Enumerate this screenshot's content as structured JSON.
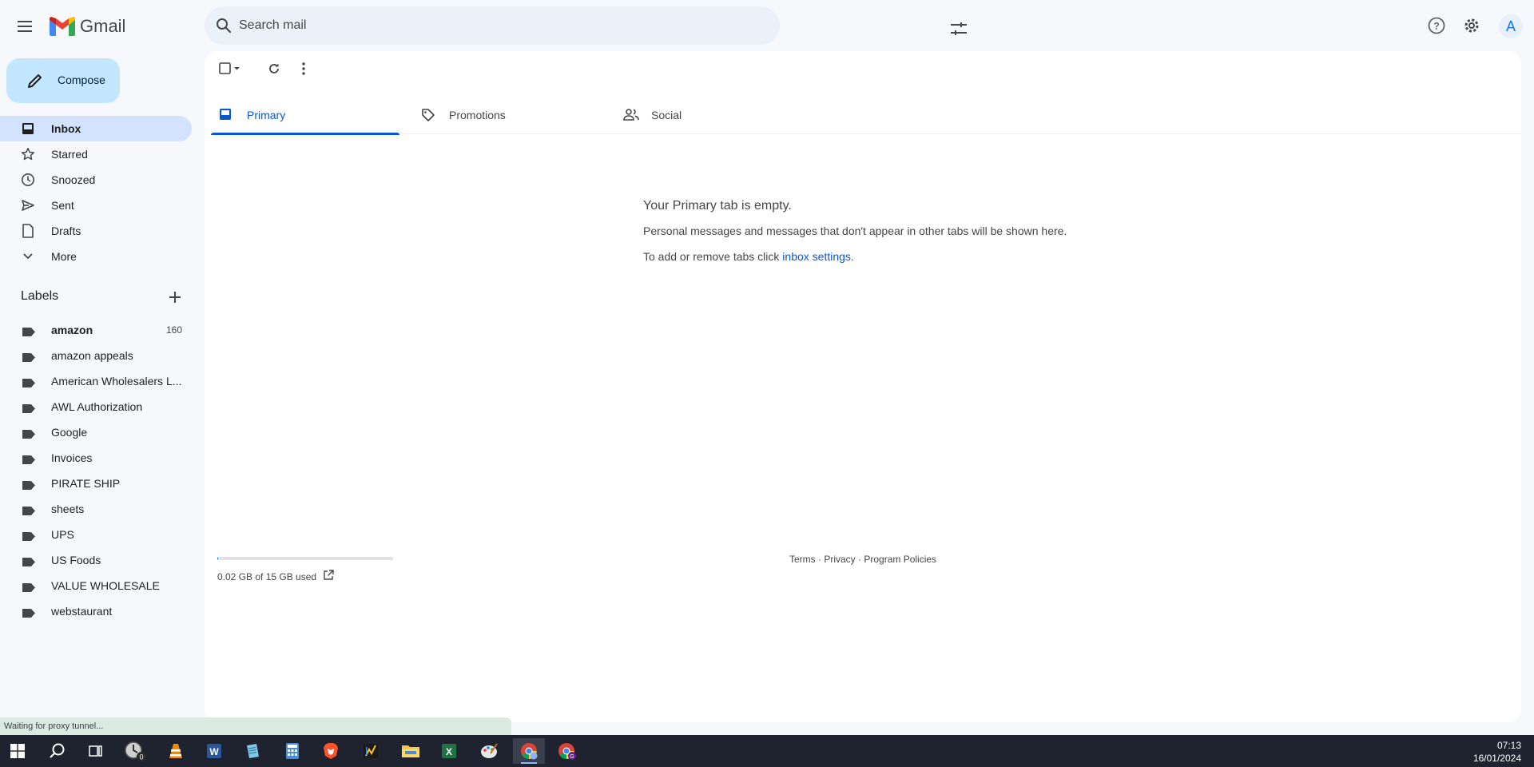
{
  "header": {
    "app_name": "Gmail",
    "search_placeholder": "Search mail",
    "avatar_initial": "A"
  },
  "sidebar": {
    "compose_label": "Compose",
    "items": [
      {
        "label": "Inbox",
        "icon": "inbox-icon",
        "active": true
      },
      {
        "label": "Starred",
        "icon": "star-icon"
      },
      {
        "label": "Snoozed",
        "icon": "clock-icon"
      },
      {
        "label": "Sent",
        "icon": "send-icon"
      },
      {
        "label": "Drafts",
        "icon": "draft-icon"
      },
      {
        "label": "More",
        "icon": "chevron-down-icon"
      }
    ],
    "labels_title": "Labels",
    "labels": [
      {
        "name": "amazon",
        "count": "160",
        "bold": true
      },
      {
        "name": "amazon appeals"
      },
      {
        "name": "American Wholesalers L..."
      },
      {
        "name": "AWL Authorization"
      },
      {
        "name": "Google"
      },
      {
        "name": "Invoices"
      },
      {
        "name": "PIRATE SHIP"
      },
      {
        "name": "sheets"
      },
      {
        "name": "UPS"
      },
      {
        "name": "US Foods"
      },
      {
        "name": "VALUE WHOLESALE"
      },
      {
        "name": "webstaurant"
      }
    ]
  },
  "tabs": [
    {
      "label": "Primary",
      "icon": "inbox-tab-icon",
      "active": true
    },
    {
      "label": "Promotions",
      "icon": "tag-icon"
    },
    {
      "label": "Social",
      "icon": "people-icon"
    }
  ],
  "empty_state": {
    "title": "Your Primary tab is empty.",
    "description": "Personal messages and messages that don't appear in other tabs will be shown here.",
    "add_prefix": "To add or remove tabs click ",
    "add_link": "inbox settings",
    "add_suffix": "."
  },
  "storage": {
    "text": "0.02 GB of 15 GB used",
    "used_fraction": 0.0013
  },
  "footer": {
    "terms": "Terms",
    "privacy": "Privacy",
    "policies": "Program Policies",
    "sep": " · "
  },
  "status_bar": {
    "text": "Waiting for proxy tunnel..."
  },
  "taskbar": {
    "time": "07:13",
    "date": "16/01/2024",
    "badge": "0",
    "chrome_badge": "G"
  },
  "colors": {
    "accent": "#0b57d0",
    "compose_bg": "#c2e7ff",
    "active_nav_bg": "#d3e3fd",
    "page_bg": "#f6f8fc",
    "taskbar_bg": "#1f2330"
  }
}
